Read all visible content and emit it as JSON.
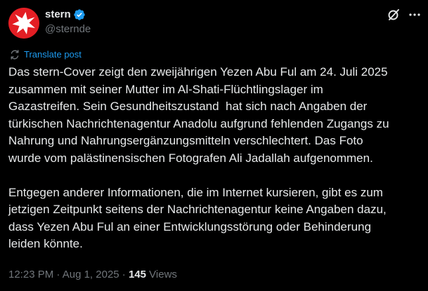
{
  "author": {
    "display_name": "stern",
    "handle": "@sternde",
    "verified": true,
    "avatar_icon": "stern-star-logo",
    "brand_color": "#e31e24"
  },
  "header_actions": {
    "grok_icon": "grok-icon",
    "more_icon": "more-dots-icon"
  },
  "translate": {
    "label": "Translate post",
    "icon": "translate-icon",
    "color": "#1d9bf0"
  },
  "body": {
    "paragraph_1": "Das stern-Cover zeigt den zweijährigen Yezen Abu Ful am 24. Juli 2025\nzusammen mit seiner Mutter im Al-Shati-Flüchtlingslager im\nGazastreifen. Sein Gesundheitszustand  hat sich nach Angaben der\ntürkischen Nachrichtenagentur Anadolu aufgrund fehlenden Zugangs zu\nNahrung und Nahrungsergänzungsmitteln verschlechtert. Das Foto\nwurde vom palästinensischen Fotografen Ali Jadallah aufgenommen.",
    "paragraph_2": "Entgegen anderer Informationen, die im Internet kursieren, gibt es zum\njetzigen Zeitpunkt seitens der Nachrichtenagentur keine Angaben dazu,\ndass Yezen Abu Ful an einer Entwicklungsstörung oder Behinderung\nleiden könnte."
  },
  "meta": {
    "time": "12:23 PM",
    "separator": " · ",
    "date": "Aug 1, 2025",
    "views_count": "145",
    "views_label": " Views"
  },
  "colors": {
    "background": "#000000",
    "text_primary": "#e7e9ea",
    "text_secondary": "#71767b",
    "verified_badge": "#1d9bf0"
  }
}
